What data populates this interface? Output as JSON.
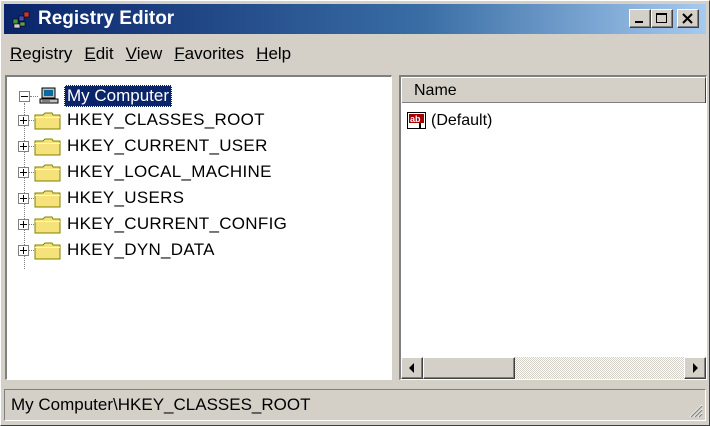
{
  "window": {
    "title": "Registry Editor"
  },
  "menu": [
    {
      "acc": "R",
      "rest": "egistry"
    },
    {
      "acc": "E",
      "rest": "dit"
    },
    {
      "acc": "V",
      "rest": "iew"
    },
    {
      "acc": "F",
      "rest": "avorites"
    },
    {
      "acc": "H",
      "rest": "elp"
    }
  ],
  "tree": {
    "root": "My Computer",
    "items": [
      "HKEY_CLASSES_ROOT",
      "HKEY_CURRENT_USER",
      "HKEY_LOCAL_MACHINE",
      "HKEY_USERS",
      "HKEY_CURRENT_CONFIG",
      "HKEY_DYN_DATA"
    ]
  },
  "list": {
    "columns": [
      "Name"
    ],
    "rows": [
      "(Default)"
    ]
  },
  "status": {
    "path": "My Computer\\HKEY_CLASSES_ROOT"
  },
  "colors": {
    "titlebar": "#0a246a",
    "selection": "#0a246a",
    "folder": "#f5e27a",
    "face": "#d4d0c8"
  }
}
